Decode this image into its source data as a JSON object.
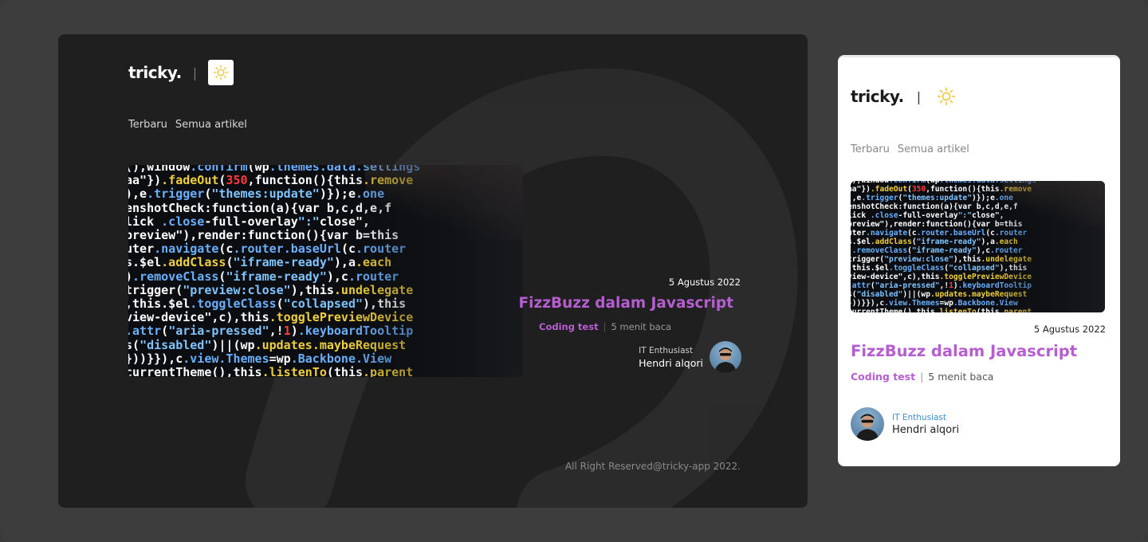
{
  "brand": {
    "name": "tricky.",
    "separator": "|"
  },
  "nav": {
    "items": [
      "Terbaru",
      "Semua artikel"
    ]
  },
  "post": {
    "date": "5 Agustus 2022",
    "title": "FizzBuzz dalam Javascript",
    "tag": "Coding test",
    "read_time": "5 menit baca",
    "meta_separator": "|",
    "author_role": "IT Enthusiast",
    "author_name": "Hendri alqori",
    "thumbnail_code": [
      "(),window.confirm(wp.themes.data.settings",
      "aa\"}).fadeOut(350,function(){this.remove",
      "),e.trigger(\"themes:update\")});e.one",
      "enshotCheck:function(a){var b,c,d,e,f",
      "lick .close-full-overlay\":\"close\",",
      "preview\"),render:function(){var b=this",
      "uter.navigate(c.router.baseUrl(c.router",
      "s.$el.addClass(\"iframe-ready\"),a.each",
      ").removeClass(\"iframe-ready\"),c.router",
      "trigger(\"preview:close\"),this.undelegate",
      ",this.$el.toggleClass(\"collapsed\"),this",
      "view-device\",c),this.togglePreviewDevice",
      ".attr(\"aria-pressed\",!1).keyboardTooltip",
      "s(\"disabled\")||(wp.updates.maybeRequest",
      "}))}}),c.view.Themes=wp.Backbone.View",
      "currentTheme(),this.listenTo(this.parent"
    ]
  },
  "footer": {
    "text": "All Right Reserved@tricky-app 2022."
  },
  "icons": {
    "theme": "sun-icon",
    "watermark": "brand-watermark-icon"
  },
  "colors": {
    "accent": "#b75dd2",
    "dark_bg": "#1f1f1f",
    "page_bg": "#3d3d3d",
    "light_bg": "#ffffff",
    "role_blue": "#3a8fd0",
    "sun_yellow": "#f2c230"
  }
}
